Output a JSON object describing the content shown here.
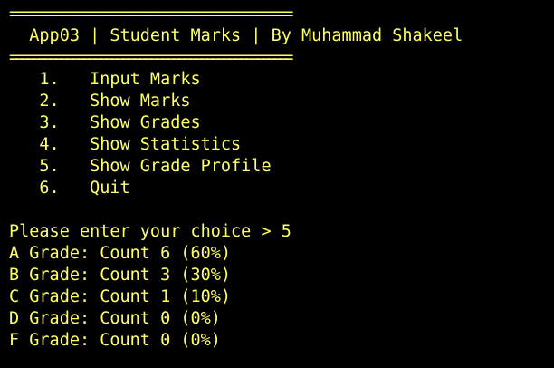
{
  "console": {
    "text_color": "#ffff66",
    "background_color": "#000000",
    "rule_top": "==================================================",
    "title": "  App03 | Student Marks | By Muhammad Shakeel",
    "rule_bottom": "==================================================",
    "menu": [
      "   1.   Input Marks",
      "   2.   Show Marks",
      "   3.   Show Grades",
      "   4.   Show Statistics",
      "   5.   Show Grade Profile",
      "   6.   Quit"
    ],
    "prompt": "Please enter your choice > 5",
    "output": [
      "A Grade: Count 6 (60%)",
      "B Grade: Count 3 (30%)",
      "C Grade: Count 1 (10%)",
      "D Grade: Count 0 (0%)",
      "F Grade: Count 0 (0%)"
    ]
  }
}
